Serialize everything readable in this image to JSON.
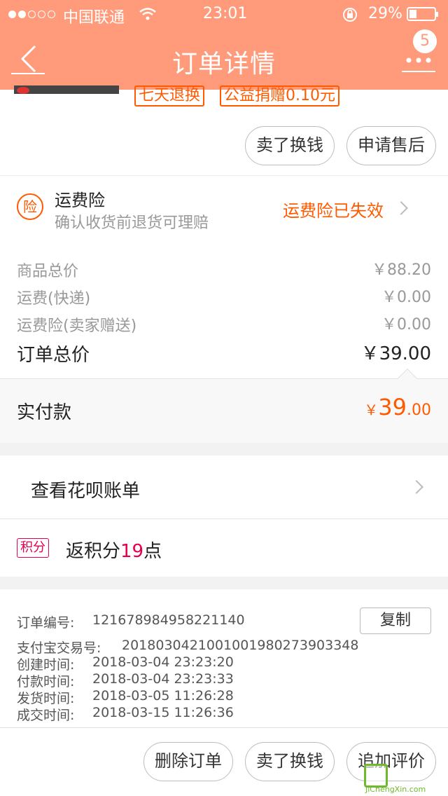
{
  "status": {
    "carrier": "中国联通",
    "time": "23:01",
    "battery": "29%"
  },
  "nav": {
    "title": "订单详情",
    "badge": "5"
  },
  "product": {
    "tags": [
      "七天退换",
      "公益捐赠0.10元"
    ]
  },
  "actions_top": [
    "卖了换钱",
    "申请售后"
  ],
  "insurance": {
    "icon": "险",
    "title": "运费险",
    "desc": "确认收货前退货可理赔",
    "status": "运费险已失效"
  },
  "price": {
    "rows": [
      {
        "label": "商品总价",
        "value": "￥88.20"
      },
      {
        "label": "运费(快递)",
        "value": "￥0.00"
      },
      {
        "label": "运费险(卖家赠送)",
        "value": "￥0.00"
      }
    ],
    "total_label": "订单总价",
    "total_value": "￥39.00",
    "paid_label": "实付款",
    "paid_symbol": "￥",
    "paid_int": "39",
    "paid_dec": ".00"
  },
  "huabei": {
    "label": "查看花呗账单"
  },
  "points": {
    "badge": "积分",
    "prefix": "返积分",
    "value": "19",
    "suffix": "点"
  },
  "order_info": {
    "copy_label": "复制",
    "rows": [
      {
        "label": "订单编号:",
        "value": "121678984958221140"
      },
      {
        "label": "支付宝交易号:",
        "value": "2018030421001001980273903348"
      },
      {
        "label": "创建时间:",
        "value": "2018-03-04 23:23:20"
      },
      {
        "label": "付款时间:",
        "value": "2018-03-04 23:23:33"
      },
      {
        "label": "发货时间:",
        "value": "2018-03-05 11:26:28"
      },
      {
        "label": "成交时间:",
        "value": "2018-03-15 11:26:36"
      }
    ]
  },
  "actions_bottom": [
    "删除订单",
    "卖了换钱",
    "追加评价"
  ],
  "watermark": {
    "text": "JiChengXin.com"
  }
}
